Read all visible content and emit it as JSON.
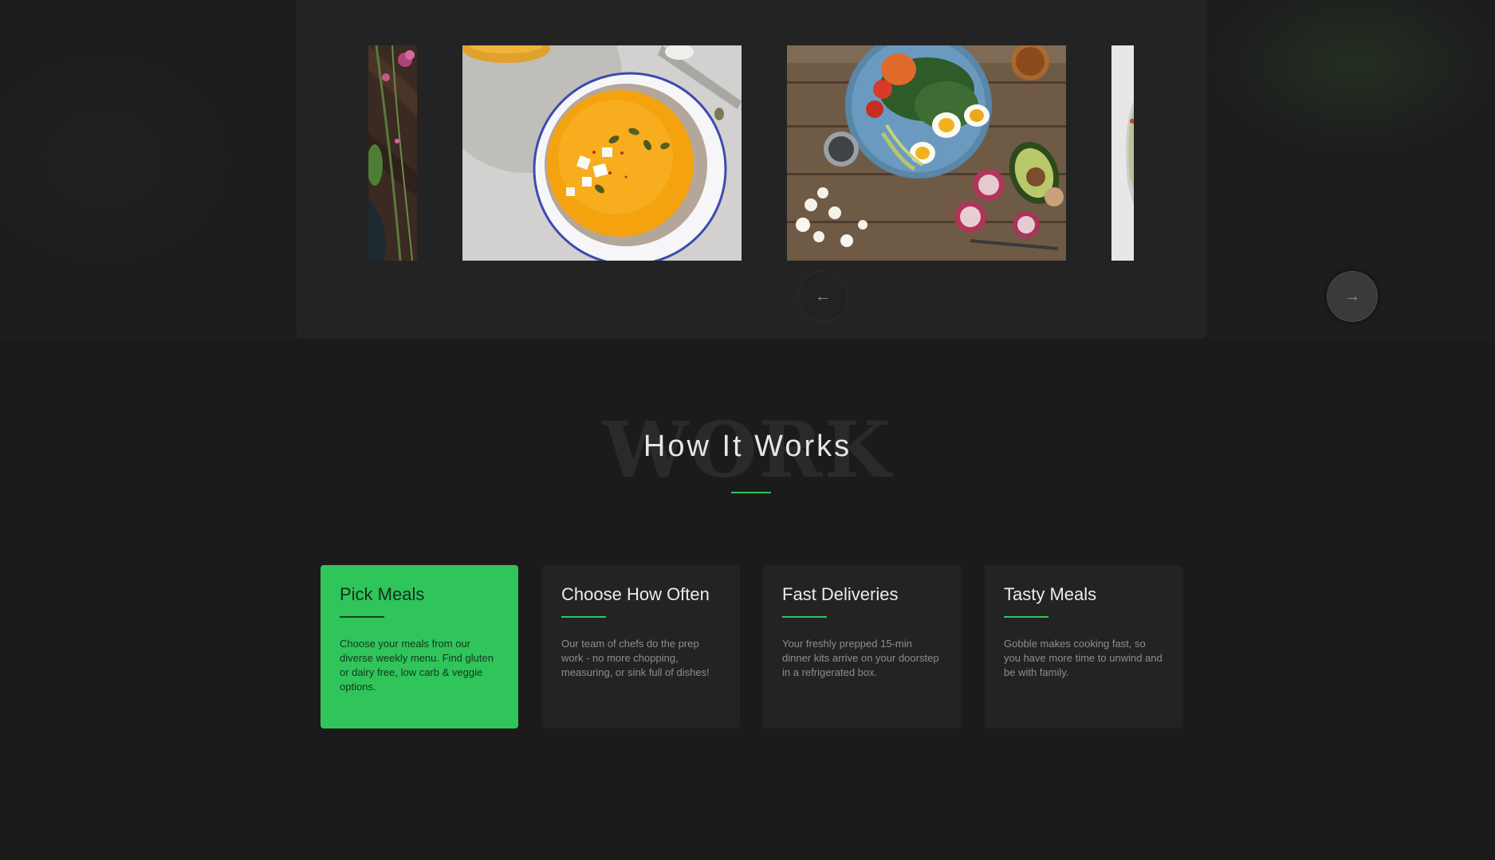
{
  "slider": {
    "prev_icon": "arrow-left-icon",
    "next_icon": "arrow-right-icon",
    "prev_glyph": "←",
    "next_glyph": "→",
    "slides": [
      {
        "subject": "flowers-on-wood"
      },
      {
        "subject": "pumpkin-soup-bowl"
      },
      {
        "subject": "salad-bowl-avocado-eggs"
      },
      {
        "subject": "white-plate"
      }
    ]
  },
  "how_it_works": {
    "background_word": "WORK",
    "title": "How It Works",
    "accent_color": "#2fc55a",
    "cards": [
      {
        "title": "Pick Meals",
        "text": "Choose your meals from our diverse weekly menu. Find gluten or dairy free, low carb & veggie options.",
        "active": true
      },
      {
        "title": "Choose How Often",
        "text": "Our team of chefs do the prep work - no more chopping, measuring, or sink full of dishes!",
        "active": false
      },
      {
        "title": "Fast Deliveries",
        "text": "Your freshly prepped 15-min dinner kits arrive on your doorstep in a refrigerated box.",
        "active": false
      },
      {
        "title": "Tasty Meals",
        "text": "Gobble makes cooking fast, so you have more time to unwind and be with family.",
        "active": false
      }
    ]
  }
}
